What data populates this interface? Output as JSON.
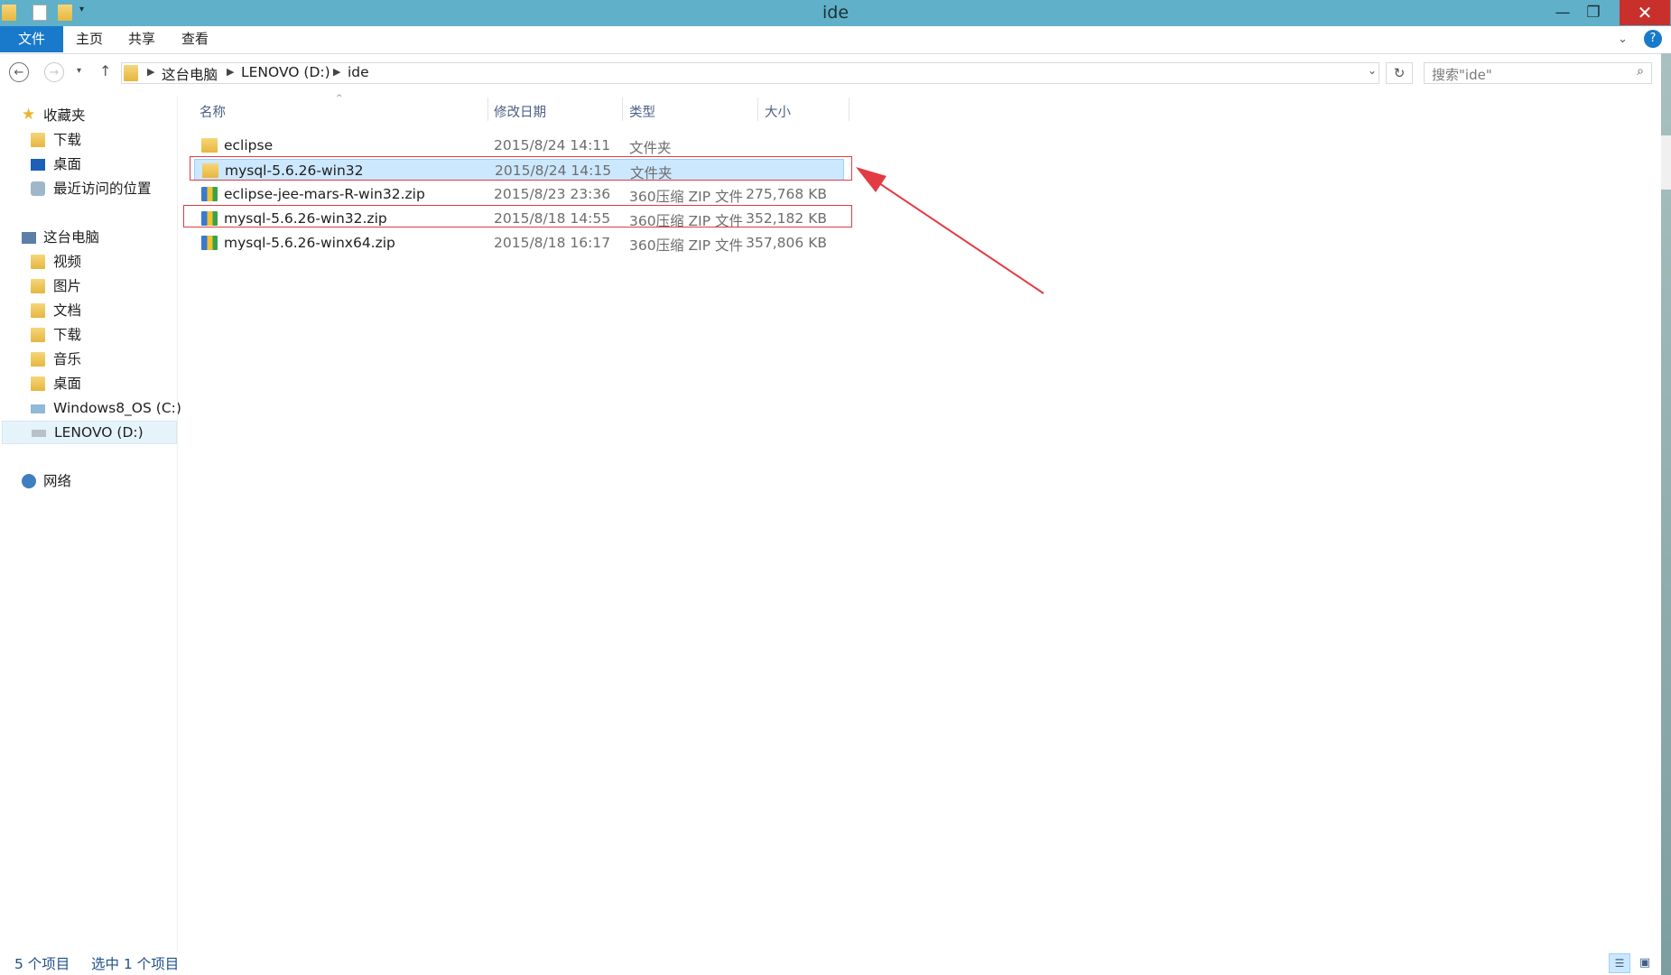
{
  "window": {
    "title": "ide"
  },
  "ribbon": {
    "tabs": [
      "文件",
      "主页",
      "共享",
      "查看"
    ]
  },
  "address": {
    "crumbs": [
      "这台电脑",
      "LENOVO (D:)",
      "ide"
    ],
    "search_placeholder": "搜索\"ide\""
  },
  "columns": {
    "name": "名称",
    "date": "修改日期",
    "type": "类型",
    "size": "大小"
  },
  "sidebar": {
    "favorites": {
      "label": "收藏夹",
      "items": [
        "下载",
        "桌面",
        "最近访问的位置"
      ]
    },
    "computer": {
      "label": "这台电脑",
      "items": [
        "视频",
        "图片",
        "文档",
        "下载",
        "音乐",
        "桌面",
        "Windows8_OS (C:)",
        "LENOVO (D:)"
      ]
    },
    "network": {
      "label": "网络"
    }
  },
  "files": [
    {
      "name": "eclipse",
      "date": "2015/8/24 14:11",
      "type": "文件夹",
      "size": "",
      "icon": "folder-icon"
    },
    {
      "name": "mysql-5.6.26-win32",
      "date": "2015/8/24 14:15",
      "type": "文件夹",
      "size": "",
      "icon": "folder-icon"
    },
    {
      "name": "eclipse-jee-mars-R-win32.zip",
      "date": "2015/8/23 23:36",
      "type": "360压缩 ZIP 文件",
      "size": "275,768 KB",
      "icon": "zip-archive-icon"
    },
    {
      "name": "mysql-5.6.26-win32.zip",
      "date": "2015/8/18 14:55",
      "type": "360压缩 ZIP 文件",
      "size": "352,182 KB",
      "icon": "zip-archive-icon"
    },
    {
      "name": "mysql-5.6.26-winx64.zip",
      "date": "2015/8/18 16:17",
      "type": "360压缩 ZIP 文件",
      "size": "357,806 KB",
      "icon": "zip-archive-icon"
    }
  ],
  "status": {
    "count": "5 个项目",
    "selected": "选中 1 个项目"
  },
  "colors": {
    "titlebar": "#5fb0c8",
    "accent": "#1979ca",
    "selection": "#cce8ff",
    "annotation": "#e23b43"
  }
}
